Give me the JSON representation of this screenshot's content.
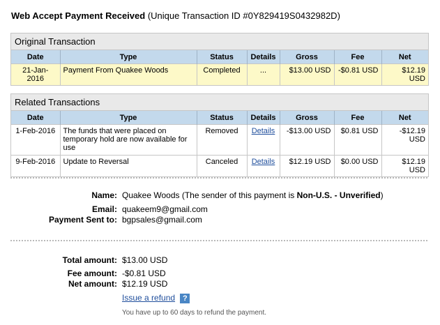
{
  "header": {
    "title": "Web Accept Payment Received",
    "transaction_id": "(Unique Transaction ID #0Y829419S0432982D)"
  },
  "original": {
    "heading": "Original Transaction",
    "columns": [
      "Date",
      "Type",
      "Status",
      "Details",
      "Gross",
      "Fee",
      "Net"
    ],
    "row": {
      "date": "21-Jan-2016",
      "type": "Payment From Quakee Woods",
      "status": "Completed",
      "details": "...",
      "gross": "$13.00 USD",
      "fee": "-$0.81 USD",
      "net": "$12.19 USD"
    }
  },
  "related": {
    "heading": "Related Transactions",
    "columns": [
      "Date",
      "Type",
      "Status",
      "Details",
      "Gross",
      "Fee",
      "Net"
    ],
    "rows": [
      {
        "date": "1-Feb-2016",
        "type": "The funds that were placed on temporary hold are now available for use",
        "status": "Removed",
        "details": "Details",
        "gross": "-$13.00 USD",
        "fee": "$0.81 USD",
        "net": "-$12.19 USD"
      },
      {
        "date": "9-Feb-2016",
        "type": "Update to Reversal",
        "status": "Canceled",
        "details": "Details",
        "gross": "$12.19 USD",
        "fee": "$0.00 USD",
        "net": "$12.19 USD"
      }
    ]
  },
  "party": {
    "name_label": "Name:",
    "name_value": "Quakee Woods (The sender of this payment is ",
    "name_status": "Non-U.S. - Unverified",
    "name_close": ")",
    "email_label": "Email:",
    "email_value": "quakeem9@gmail.com",
    "sent_to_label": "Payment Sent to:",
    "sent_to_value": "bgpsales@gmail.com"
  },
  "amounts": {
    "total_label": "Total amount:",
    "total_value": "$13.00 USD",
    "fee_label": "Fee amount:",
    "fee_value": "-$0.81 USD",
    "net_label": "Net amount:",
    "net_value": "$12.19 USD",
    "refund_link": "Issue a refund",
    "help_icon": "?",
    "refund_note": "You have up to 60 days to refund the payment."
  }
}
